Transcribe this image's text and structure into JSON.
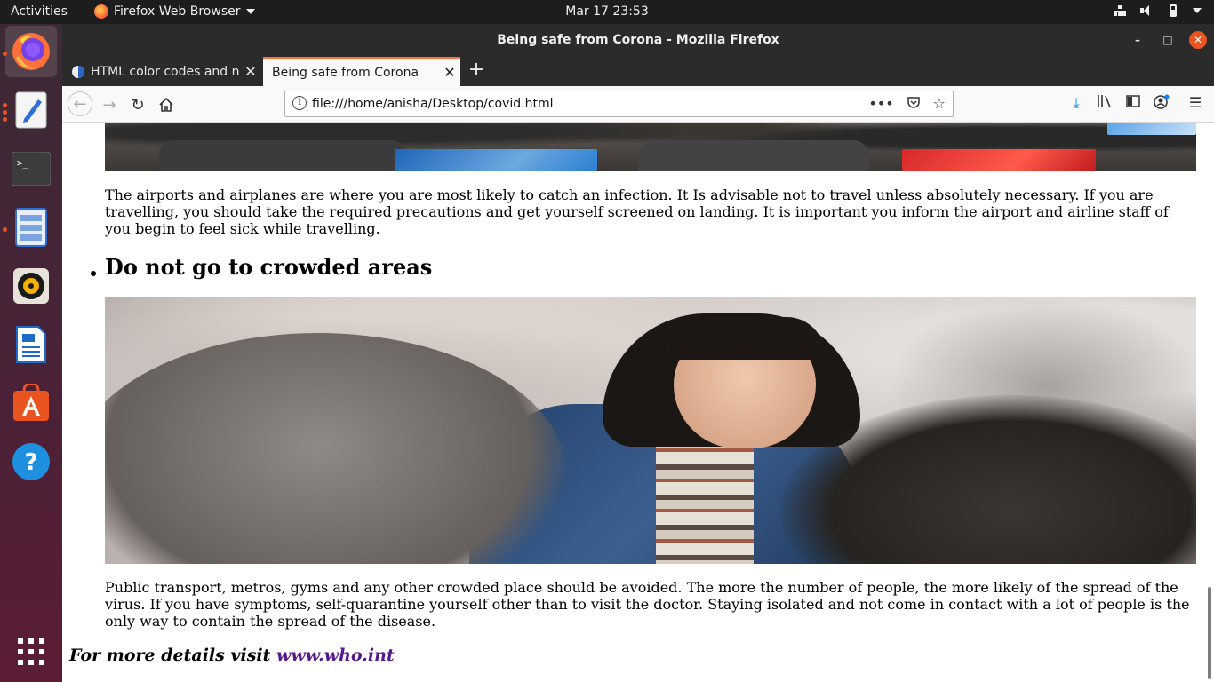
{
  "topbar": {
    "activities": "Activities",
    "app_name": "Firefox Web Browser",
    "datetime": "Mar 17  23:53"
  },
  "dock": {
    "items": [
      "firefox",
      "text-editor",
      "terminal",
      "files",
      "rhythmbox",
      "libreoffice-writer",
      "software-center",
      "help"
    ],
    "apps_label": "Show Applications"
  },
  "window": {
    "title": "Being safe from Corona - Mozilla Firefox"
  },
  "tabs": [
    {
      "label": "HTML color codes and na",
      "active": false
    },
    {
      "label": "Being safe from Corona",
      "active": true
    }
  ],
  "navbar": {
    "url": "file:///home/anisha/Desktop/covid.html",
    "page_actions": "•••"
  },
  "page": {
    "airport_paragraph": "The airports and airplanes are where you are most likely to catch an infection. It Is advisable not to travel unless absolutely necessary. If you are travelling, you should take the required precautions and get yourself screened on landing. It is important you inform the airport and airline staff of you begin to feel sick while travelling.",
    "crowded_heading": "Do not go to crowded areas",
    "crowded_paragraph": "Public transport, metros, gyms and any other crowded place should be avoided. The more the number of people, the more likely of the spread of the virus. If you have symptoms, self-quarantine yourself other than to visit the doctor. Staying isolated and not come in contact with a lot of people is the only way to contain the spread of the disease.",
    "more_details_text": "For more details visit",
    "more_details_link": " www.who.int"
  },
  "colors": {
    "accent": "#e95420",
    "link_visited": "#551a8b",
    "tab_highlight": "#ff7139"
  }
}
